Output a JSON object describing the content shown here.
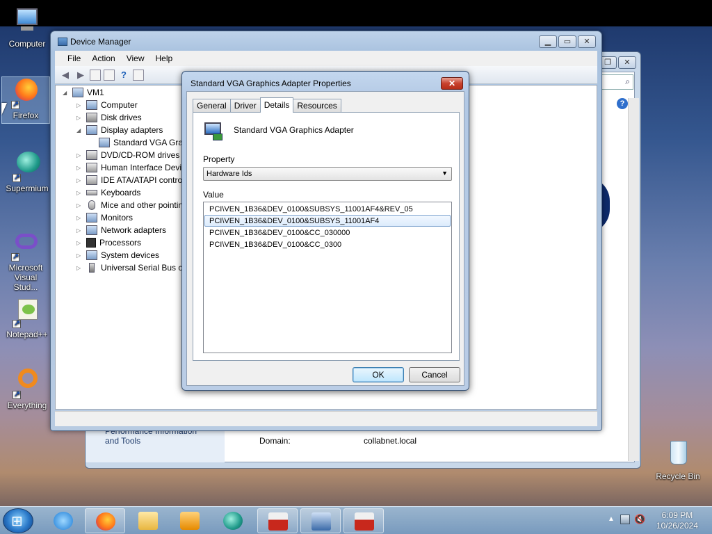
{
  "desktop": {
    "icons": [
      {
        "label": "Computer"
      },
      {
        "label": "Firefox"
      },
      {
        "label": "Supermium"
      },
      {
        "label": "Microsoft Visual Stud..."
      },
      {
        "label": "Notepad++"
      },
      {
        "label": "Everything"
      },
      {
        "label": "Recycle Bin"
      }
    ]
  },
  "system_window": {
    "left_link": "Performance Information and Tools",
    "domain_label": "Domain:",
    "domain_value": "collabnet.local"
  },
  "device_manager": {
    "title": "Device Manager",
    "menu": [
      "File",
      "Action",
      "View",
      "Help"
    ],
    "tree": [
      {
        "label": "VM1",
        "level": 0,
        "expanded": true
      },
      {
        "label": "Computer",
        "level": 1
      },
      {
        "label": "Disk drives",
        "level": 1
      },
      {
        "label": "Display adapters",
        "level": 1,
        "expanded": true
      },
      {
        "label": "Standard VGA Grap",
        "level": 2
      },
      {
        "label": "DVD/CD-ROM drives",
        "level": 1
      },
      {
        "label": "Human Interface Devic",
        "level": 1
      },
      {
        "label": "IDE ATA/ATAPI contro",
        "level": 1
      },
      {
        "label": "Keyboards",
        "level": 1
      },
      {
        "label": "Mice and other pointin",
        "level": 1
      },
      {
        "label": "Monitors",
        "level": 1
      },
      {
        "label": "Network adapters",
        "level": 1
      },
      {
        "label": "Processors",
        "level": 1
      },
      {
        "label": "System devices",
        "level": 1
      },
      {
        "label": "Universal Serial Bus co",
        "level": 1
      }
    ]
  },
  "dialog": {
    "title": "Standard VGA Graphics Adapter Properties",
    "close_label": "✕",
    "tabs": [
      "General",
      "Driver",
      "Details",
      "Resources"
    ],
    "active_tab": "Details",
    "device_name": "Standard VGA Graphics Adapter",
    "property_label": "Property",
    "property_value": "Hardware Ids",
    "value_label": "Value",
    "values": [
      "PCI\\VEN_1B36&DEV_0100&SUBSYS_11001AF4&REV_05",
      "PCI\\VEN_1B36&DEV_0100&SUBSYS_11001AF4",
      "PCI\\VEN_1B36&DEV_0100&CC_030000",
      "PCI\\VEN_1B36&DEV_0100&CC_0300"
    ],
    "selected_index": 1,
    "ok_label": "OK",
    "cancel_label": "Cancel"
  },
  "taskbar": {
    "time": "6:09 PM",
    "date": "10/26/2024"
  }
}
